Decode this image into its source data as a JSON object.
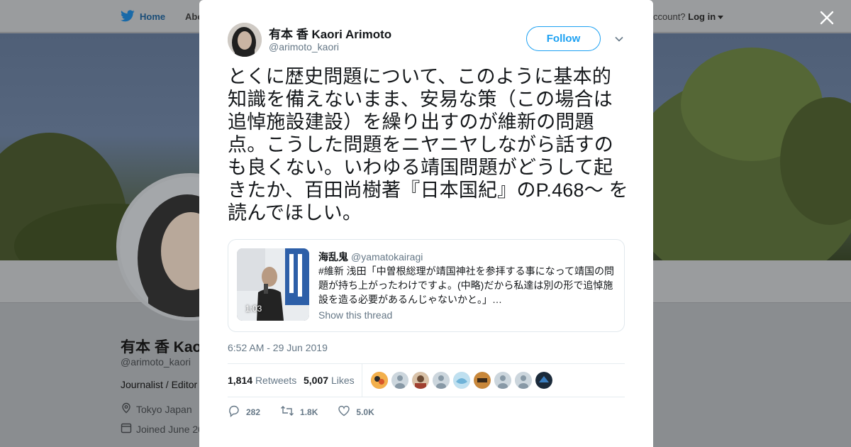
{
  "background": {
    "nav": {
      "home_label": "Home",
      "about_label": "Abo",
      "account_prompt": "ccount?",
      "login_label": "Log in"
    },
    "profile": {
      "name": "有本 香 Kao",
      "handle": "@arimoto_kaori",
      "bio": "Journalist / Editor",
      "location": "Tokyo Japan",
      "joined": "Joined June 20"
    }
  },
  "tweet": {
    "author": {
      "name": "有本 香 Kaori Arimoto",
      "handle": "@arimoto_kaori"
    },
    "follow_label": "Follow",
    "text": "とくに歴史問題について、このように基本的知識を備えないまま、安易な策（この場合は追悼施設建設）を繰り出すのが維新の問題点。こうした問題をニヤニヤしながら話すのも良くない。いわゆる靖国問題がどうして起きたか、百田尚樹著『日本国紀』のP.468～ を読んでほしい。",
    "quoted": {
      "name": "海乱鬼",
      "handle": "@yamatokairagi",
      "text": "#維新 浅田「中曽根総理が靖国神社を参拝する事になって靖国の問題が持ち上がったわけですよ。(中略)だから私達は別の形で追悼施設を造る必要があるんじゃないかと。」…",
      "video_duration": "1:03",
      "thread_link": "Show this thread"
    },
    "timestamp": "6:52 AM - 29 Jun 2019",
    "retweets_count": "1,814",
    "retweets_label": "Retweets",
    "likes_count": "5,007",
    "likes_label": "Likes",
    "actions": {
      "reply_count": "282",
      "retweet_count": "1.8K",
      "like_count": "5.0K"
    }
  },
  "colors": {
    "accent": "#1da1f2",
    "text": "#14171a",
    "muted": "#657786",
    "border": "#e6ecf0"
  },
  "icons": [
    "twitter-bird-icon",
    "close-icon",
    "chevron-down-icon",
    "location-icon",
    "calendar-icon",
    "reply-icon",
    "retweet-icon",
    "heart-icon"
  ]
}
